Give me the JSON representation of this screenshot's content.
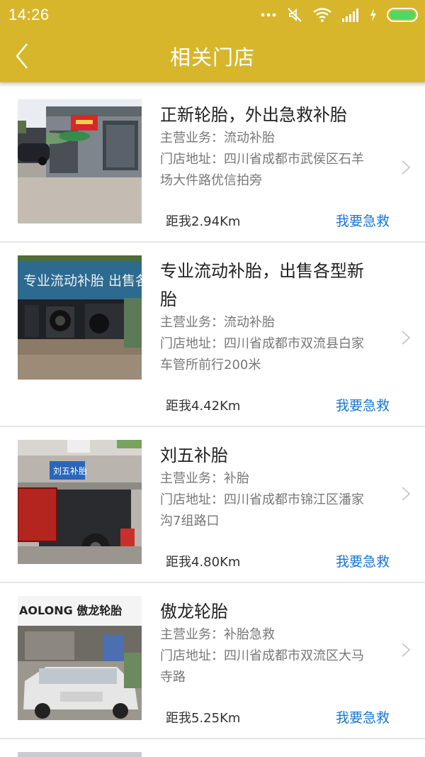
{
  "status_bar": {
    "time": "14:26",
    "icons": [
      "more-dots-icon",
      "mute-icon",
      "wifi-icon",
      "signal-icon",
      "charging-icon",
      "battery-icon"
    ]
  },
  "app_bar": {
    "title": "相关门店",
    "back_icon": "chevron-left-icon"
  },
  "colors": {
    "accent": "#d8b62b",
    "link": "#1976d2",
    "title_text": "#222222",
    "secondary_text": "#777777",
    "background": "#f2f2f2"
  },
  "stores": [
    {
      "name": "正新轮胎，外出急救补胎",
      "business": "主营业务：流动补胎",
      "address_line1": "门店地址：四川省成都市武侯区石羊",
      "address_line2": "场大件路优信拍旁",
      "distance": "距我2.94Km",
      "action": "我要急救"
    },
    {
      "name_line1": "专业流动补胎，出售各型新",
      "name_line2": "胎",
      "sign_text": "专业流动补胎 出售各型新胎",
      "business": "主营业务：流动补胎",
      "address_line1": "门店地址：四川省成都市双流县白家",
      "address_line2": "车管所前行200米",
      "distance": "距我4.42Km",
      "action": "我要急救"
    },
    {
      "name": "刘五补胎",
      "sign_text": "刘五补胎",
      "business": "主营业务：补胎",
      "address_line1": "门店地址：四川省成都市锦江区潘家",
      "address_line2": "沟7组路口",
      "distance": "距我4.80Km",
      "action": "我要急救"
    },
    {
      "name": "傲龙轮胎",
      "sign_text": "AOLONG 傲龙轮胎",
      "business": "主营业务：补胎急救",
      "address_line1": "门店地址：四川省成都市双流区大马",
      "address_line2": "寺路",
      "distance": "距我5.25Km",
      "action": "我要急救"
    }
  ]
}
